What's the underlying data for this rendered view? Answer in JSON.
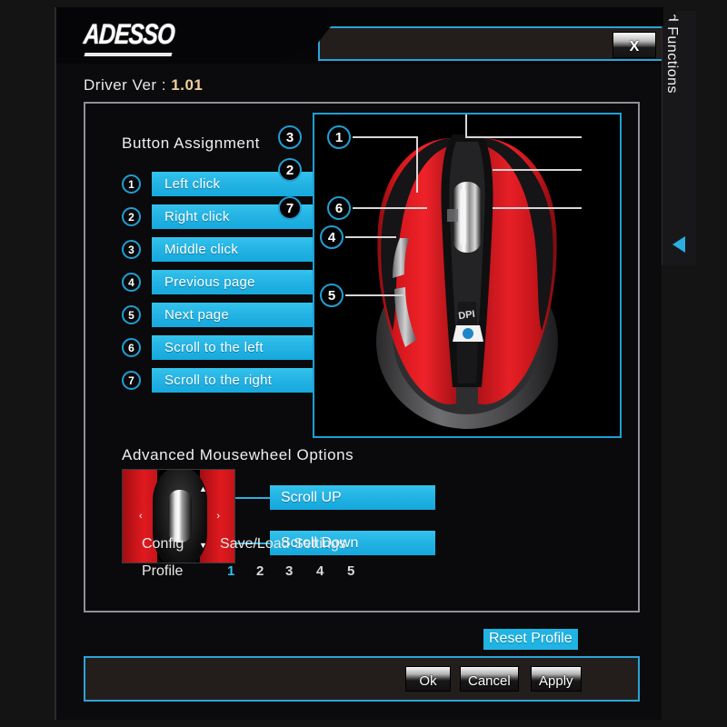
{
  "window": {
    "logo": "ADESSO",
    "close_label": "X",
    "driver_label": "Driver Ver :",
    "driver_version": "1.01"
  },
  "side_tab": {
    "label": "Advanced Functions",
    "arrow_icon": "triangle-left-icon"
  },
  "button_assignment": {
    "heading": "Button Assignment",
    "rows": [
      {
        "num": "1",
        "label": "Left click"
      },
      {
        "num": "2",
        "label": "Right click"
      },
      {
        "num": "3",
        "label": "Middle click"
      },
      {
        "num": "4",
        "label": "Previous page"
      },
      {
        "num": "5",
        "label": "Next page"
      },
      {
        "num": "6",
        "label": "Scroll to the left"
      },
      {
        "num": "7",
        "label": "Scroll to the right"
      }
    ]
  },
  "mousewheel": {
    "heading": "Advanced Mousewheel Options",
    "scroll_up": "Scroll UP",
    "scroll_down": "Scroll Down",
    "left_marker": "‹",
    "right_marker": "›",
    "up_arrow": "▲",
    "down_arrow": "▼"
  },
  "diagram": {
    "callouts": [
      "1",
      "2",
      "3",
      "4",
      "5",
      "6",
      "7"
    ],
    "dpi_label": "DPI"
  },
  "config": {
    "config_label": "Config",
    "profile_label": "Profile",
    "save_load_label": "Save/Load Settings",
    "profiles": [
      "1",
      "2",
      "3",
      "4",
      "5"
    ],
    "active_profile": "1",
    "reset_label": "Reset Profile"
  },
  "footer": {
    "ok": "Ok",
    "cancel": "Cancel",
    "apply": "Apply"
  },
  "colors": {
    "accent_cyan": "#22b2e3",
    "mouse_red": "#d4161c",
    "panel_border": "#8d9096",
    "version_text": "#f0cf9a"
  }
}
